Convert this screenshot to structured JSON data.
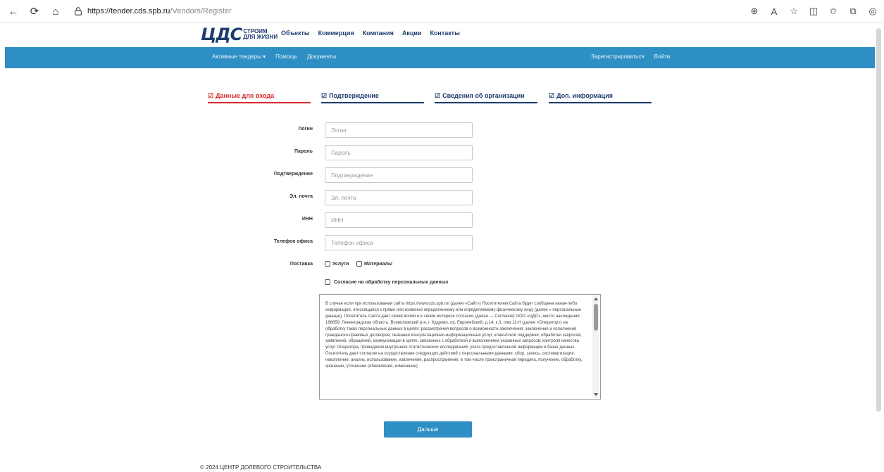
{
  "browser": {
    "url_host": "https://tender.cds.spb.ru",
    "url_path": "/Vendors/Register"
  },
  "site": {
    "logo_mark": "ЦДС",
    "logo_line1": "СТРОИМ",
    "logo_line2": "ДЛЯ ЖИЗНИ",
    "nav": [
      "Объекты",
      "Коммерция",
      "Компания",
      "Акции",
      "Контакты"
    ]
  },
  "subnav": {
    "active_tenders": "Активные тендеры ▾",
    "help": "Помощь",
    "documents": "Документы",
    "register": "Зарегистрироваться",
    "login": "Войти"
  },
  "steps": [
    {
      "label": "Данные для входа",
      "active": true
    },
    {
      "label": "Подтверждение",
      "active": false
    },
    {
      "label": "Сведения об организации",
      "active": false
    },
    {
      "label": "Доп. информация",
      "active": false
    }
  ],
  "form": {
    "login_label": "Логин",
    "login_placeholder": "Логин",
    "password_label": "Пароль",
    "password_placeholder": "Пароль",
    "confirm_label": "Подтверждение",
    "confirm_placeholder": "Подтверждение",
    "email_label": "Эл. почта",
    "email_placeholder": "Эл. почта",
    "inn_label": "ИНН",
    "inn_placeholder": "ИНН",
    "phone_label": "Телефон офиса",
    "phone_placeholder": "Телефон офиса",
    "supply_label": "Поставка",
    "supply_services": "Услуги",
    "supply_materials": "Материалы",
    "consent_label": "Согласие на обработку персональных данных"
  },
  "agreement_text": "В случае если при использовании сайта https://www.cds.spb.ru/ (далее «Сайт») Посетителем Сайта будет сообщена какая-либо информация, относящаяся к прямо или косвенно определенному или определяемому физическому лицу (далее « персональные данные), Посетитель Сайта дает своей волей и в своем интересе согласие (далее — Согласие) ООО «ЦДС», место нахождения: 188659, Ленинградская область, Всеволожский р-н, г. Кудрово, пр. Европейский, д.14, к.3, пом.11-Н (далее «Оператор») на обработку таких персональных данных в целях: рассмотрения вопросов о возможности заключения, заключения и исполнения гражданско-правовых договоров; оказания консультационно-информационных услуг, клиентской поддержки; обработки запросов, заявлений, обращений, коммуникации в целях, связанных с обработкой и выполнением указанных запросов; контроля качества услуг Оператора, проведения внутренних статистических исследований; учета предоставленной информации в базах данных. Посетитель дает согласие на осуществление следующих действий с персональными данными: сбор, запись, систематизация, накопление, анализ, использование, извлечение, распространение, в том числе трансграничная передача, получение, обработку, хранение, уточнение (обновление, изменение)",
  "next_button": "Дальше",
  "footer": "© 2024 ЦЕНТР ДОЛЕВОГО СТРОИТЕЛЬСТВА"
}
